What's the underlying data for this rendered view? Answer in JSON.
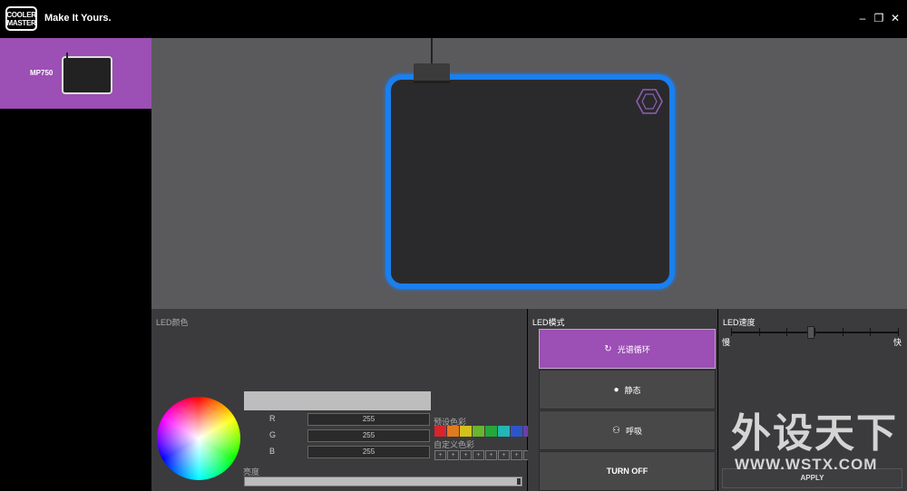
{
  "titlebar": {
    "logo_line1": "COOLER",
    "logo_line2": "MASTER",
    "tagline": "Make It Yours.",
    "minimize": "–",
    "maximize": "❐",
    "close": "✕"
  },
  "sidebar": {
    "device_name": "MP750"
  },
  "led_color": {
    "label": "LED颜色",
    "r_label": "R",
    "g_label": "G",
    "b_label": "B",
    "r_value": "255",
    "g_value": "255",
    "b_value": "255",
    "preset_label": "预设色彩",
    "custom_label": "自定义色彩",
    "brightness_label": "亮度",
    "preset_colors": [
      "#d8242b",
      "#e07a1e",
      "#d3c21b",
      "#69b52d",
      "#24a83a",
      "#23b6b4",
      "#2d55c9",
      "#6a3fa8"
    ],
    "custom_slot": "+",
    "brightness": 1.0
  },
  "led_mode": {
    "label": "LED模式",
    "spectrum": "光谱循环",
    "static": "静态",
    "breathing": "呼吸",
    "turn_off": "TURN OFF"
  },
  "led_speed": {
    "label": "LED速度",
    "slow": "慢",
    "fast": "快",
    "apply": "APPLY",
    "level": 0.5
  },
  "watermark": {
    "big": "外设天下",
    "small": "WWW.WSTX.COM"
  },
  "colors": {
    "accent": "#9c4fb4",
    "glow": "#1a7ff0"
  }
}
